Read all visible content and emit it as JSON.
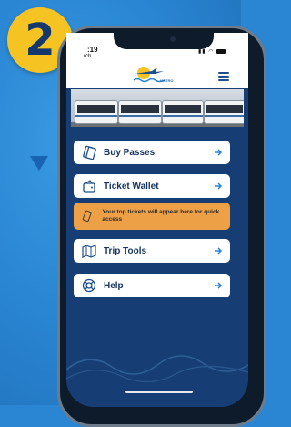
{
  "step": {
    "number": "2"
  },
  "status_bar": {
    "time": ":19",
    "back": "rch"
  },
  "app": {
    "logo_text": "METRO",
    "menu_icon": "hamburger-icon",
    "accent_color": "#2a86d3"
  },
  "menu": {
    "buy_passes": "Buy Passes",
    "ticket_wallet": "Ticket Wallet",
    "notice": "Your top tickets will appear here for quick access",
    "trip_tools": "Trip Tools",
    "help": "Help"
  },
  "icons": {
    "buy_passes": "tickets-icon",
    "ticket_wallet": "wallet-icon",
    "notice": "ticket-icon",
    "trip_tools": "map-icon",
    "help": "lifebuoy-icon",
    "arrow": "arrow-right-icon"
  }
}
